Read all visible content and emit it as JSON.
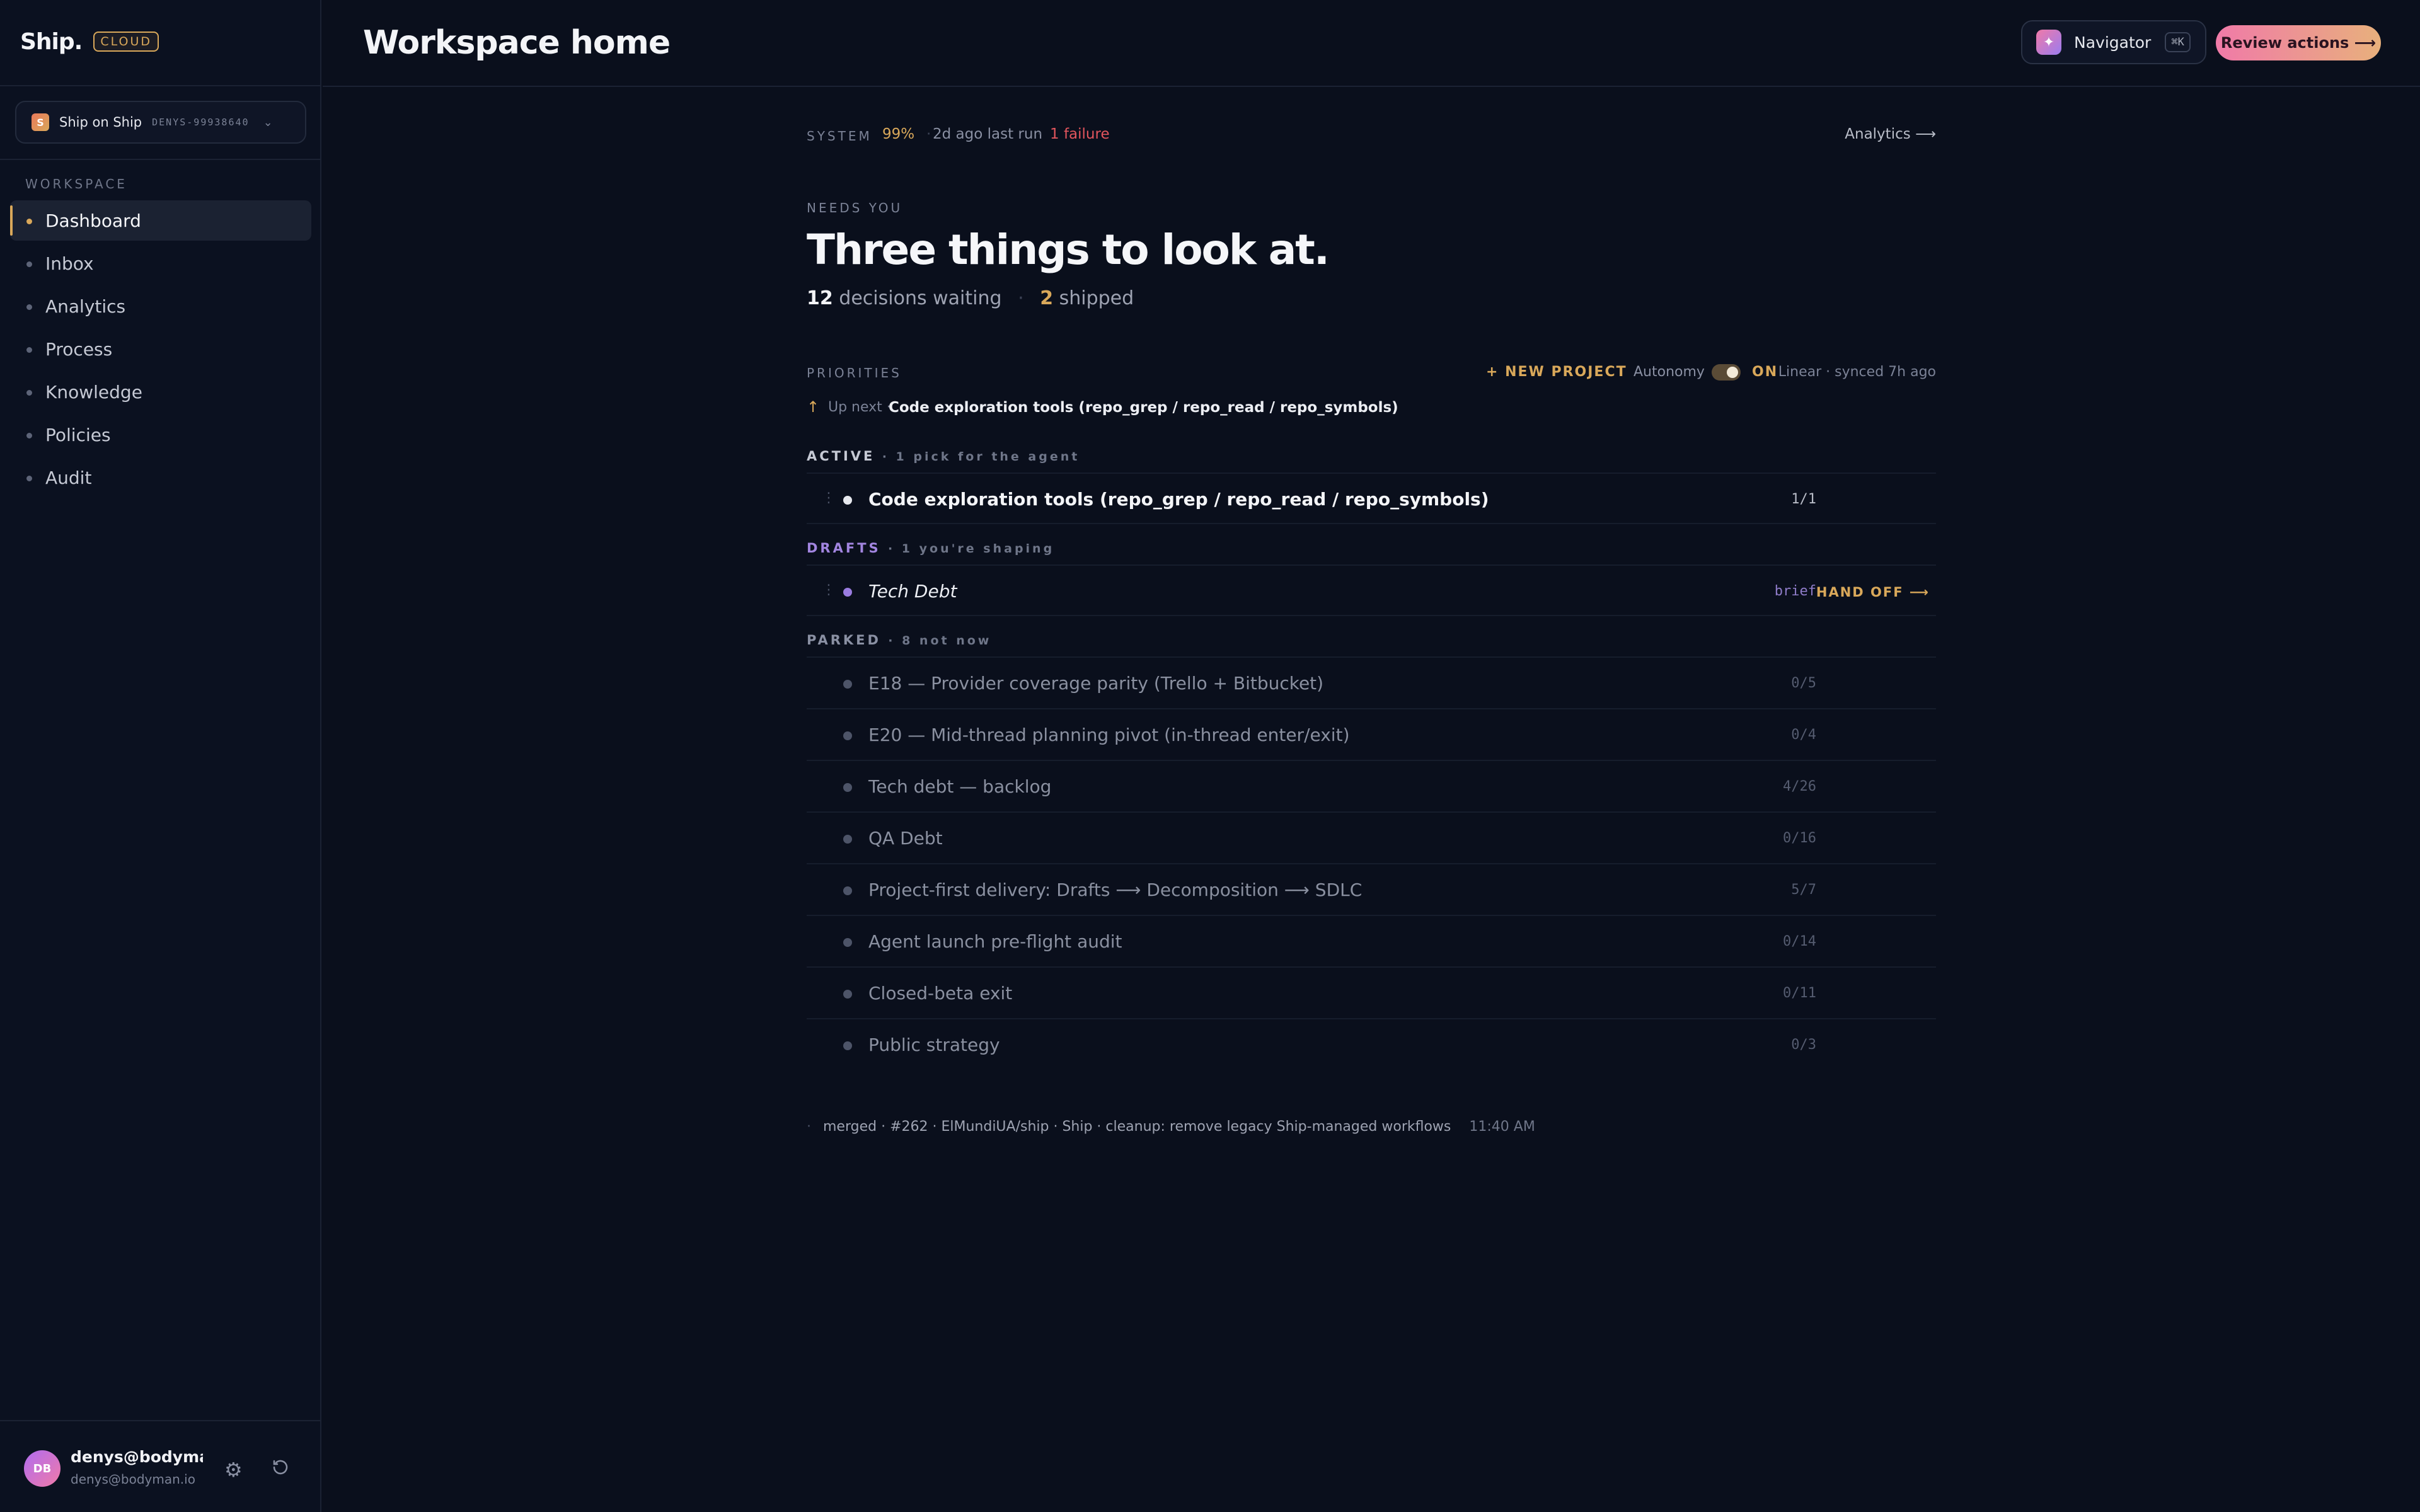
{
  "brand": {
    "name": "Ship.",
    "tag": "CLOUD"
  },
  "workspace_select": {
    "logo_letter": "S",
    "name": "Ship on Ship",
    "id": "DENYS-99938640"
  },
  "sidebar": {
    "section_label": "WORKSPACE",
    "items": [
      {
        "label": "Dashboard",
        "active": true
      },
      {
        "label": "Inbox"
      },
      {
        "label": "Analytics"
      },
      {
        "label": "Process"
      },
      {
        "label": "Knowledge"
      },
      {
        "label": "Policies"
      },
      {
        "label": "Audit"
      }
    ]
  },
  "user": {
    "initials": "DB",
    "name": "denys@bodyma...",
    "email": "denys@bodyman.io"
  },
  "header": {
    "title": "Workspace home",
    "navigator_label": "Navigator",
    "navigator_shortcut": "⌘K",
    "review_label": "Review actions ⟶"
  },
  "system": {
    "label": "SYSTEM",
    "percent": "99%",
    "sep": "·",
    "last_run": "2d ago last run",
    "failures": "1 failure",
    "analytics_link": "Analytics ⟶"
  },
  "needs_you": {
    "label": "NEEDS YOU",
    "headline": "Three things to look at.",
    "decisions_count": "12",
    "decisions_label": "decisions waiting",
    "sep": "·",
    "shipped_count": "2",
    "shipped_label": "shipped"
  },
  "priorities": {
    "label": "PRIORITIES",
    "new_project": "+ NEW PROJECT",
    "autonomy_label": "Autonomy",
    "autonomy_state": "ON",
    "synced": "Linear · synced 7h ago",
    "upnext_label": "Up next ·",
    "upnext_title": "Code exploration tools (repo_grep / repo_read / repo_symbols)"
  },
  "sections": {
    "active": {
      "label": "ACTIVE",
      "sub": "· 1 pick for the agent"
    },
    "drafts": {
      "label": "DRAFTS",
      "sub": "· 1 you're shaping"
    },
    "parked": {
      "label": "PARKED",
      "sub": "· 8 not now"
    }
  },
  "active_rows": [
    {
      "title": "Code exploration tools (repo_grep / repo_read / repo_symbols)",
      "count": "1/1"
    }
  ],
  "draft_rows": [
    {
      "title": "Tech Debt",
      "tag": "brief",
      "action": "HAND OFF ⟶"
    }
  ],
  "parked_rows": [
    {
      "title": "E18 — Provider coverage parity (Trello + Bitbucket)",
      "count": "0/5"
    },
    {
      "title": "E20 — Mid-thread planning pivot (in-thread enter/exit)",
      "count": "0/4"
    },
    {
      "title": "Tech debt — backlog",
      "count": "4/26"
    },
    {
      "title": "QA Debt",
      "count": "0/16"
    },
    {
      "title": "Project-first delivery: Drafts ⟶ Decomposition ⟶ SDLC",
      "count": "5/7"
    },
    {
      "title": "Agent launch pre-flight audit",
      "count": "0/14"
    },
    {
      "title": "Closed-beta exit",
      "count": "0/11"
    },
    {
      "title": "Public strategy",
      "count": "0/3"
    }
  ],
  "activity": {
    "dot": "·",
    "text": "merged · #262 · ElMundiUA/ship · Ship · cleanup: remove legacy Ship-managed workflows",
    "time": "11:40 AM"
  }
}
